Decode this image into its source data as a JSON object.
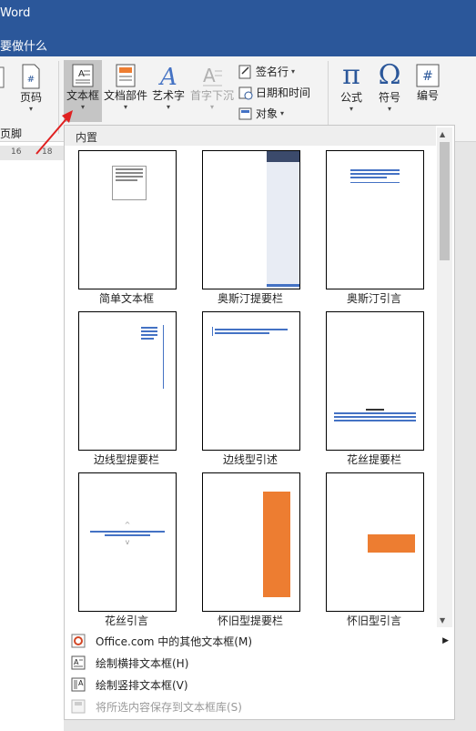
{
  "window": {
    "title_fragment": "Word",
    "tell_me": "要做什么"
  },
  "ribbon": {
    "left_partial_label": "页码",
    "left_partial_label2": "页脚",
    "left_clip_label": "",
    "buttons": {
      "textbox": "文本框",
      "quickparts": "文档部件",
      "wordart": "艺术字",
      "dropcap": "首字下沉",
      "equation": "公式",
      "symbol": "符号",
      "number": "编号"
    },
    "small": {
      "signature": "签名行",
      "datetime": "日期和时间",
      "object": "对象"
    },
    "ruler_ticks": [
      "16",
      "18"
    ]
  },
  "gallery": {
    "section_label": "内置",
    "items": [
      {
        "label": "简单文本框"
      },
      {
        "label": "奥斯汀提要栏"
      },
      {
        "label": "奥斯汀引言"
      },
      {
        "label": "边线型提要栏"
      },
      {
        "label": "边线型引述"
      },
      {
        "label": "花丝提要栏"
      },
      {
        "label": "花丝引言"
      },
      {
        "label": "怀旧型提要栏"
      },
      {
        "label": "怀旧型引言"
      }
    ]
  },
  "menu": {
    "items": [
      {
        "label": "Office.com 中的其他文本框(M)",
        "icon": "office-icon",
        "enabled": true
      },
      {
        "label": "绘制横排文本框(H)",
        "icon": "horizontal-textbox-icon",
        "enabled": true
      },
      {
        "label": "绘制竖排文本框(V)",
        "icon": "vertical-textbox-icon",
        "enabled": true
      },
      {
        "label": "将所选内容保存到文本框库(S)",
        "icon": "save-to-gallery-icon",
        "enabled": false
      }
    ]
  },
  "colors": {
    "brand": "#2b579a",
    "accent_orange": "#ed7d31",
    "accent_blue": "#4472c4"
  }
}
